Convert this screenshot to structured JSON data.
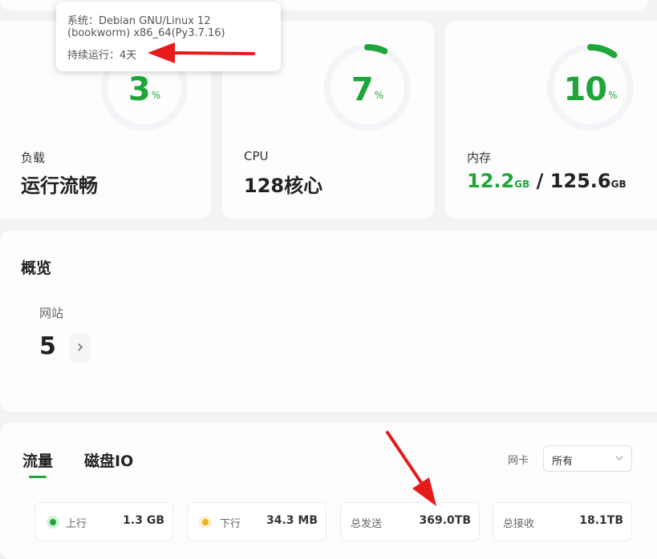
{
  "tooltip": {
    "system_line1": "系统：Debian GNU/Linux 12",
    "system_line2": "(bookworm) x86_64(Py3.7.16)",
    "uptime": "持续运行：4天"
  },
  "stats": {
    "load": {
      "percent": "3",
      "percent_unit": "%",
      "fraction": 0.03,
      "label": "负载",
      "value": "运行流畅"
    },
    "cpu": {
      "percent": "7",
      "percent_unit": "%",
      "fraction": 0.07,
      "label": "CPU",
      "value": "128核心"
    },
    "memory": {
      "percent": "10",
      "percent_unit": "%",
      "fraction": 0.1,
      "label": "内存",
      "used": "12.2",
      "used_unit": "GB",
      "separator": " / ",
      "total": "125.6",
      "total_unit": "GB"
    }
  },
  "overview": {
    "title": "概览",
    "sites_label": "网站",
    "sites_count": "5",
    "arrow": "›"
  },
  "traffic": {
    "tabs": [
      {
        "label": "流量",
        "active": true
      },
      {
        "label": "磁盘IO",
        "active": false
      }
    ],
    "nic_label": "网卡",
    "nic_selected": "所有",
    "metrics": [
      {
        "label": "上行",
        "value": "1.3 GB",
        "dot_color": "#20a53a"
      },
      {
        "label": "下行",
        "value": "34.3 MB",
        "dot_color": "#f0ad1e"
      },
      {
        "label": "总发送",
        "value": "369.0TB"
      },
      {
        "label": "总接收",
        "value": "18.1TB"
      }
    ]
  },
  "colors": {
    "accent": "#20a53a",
    "arrow": "#e8191b",
    "track": "#f2f4f8"
  }
}
